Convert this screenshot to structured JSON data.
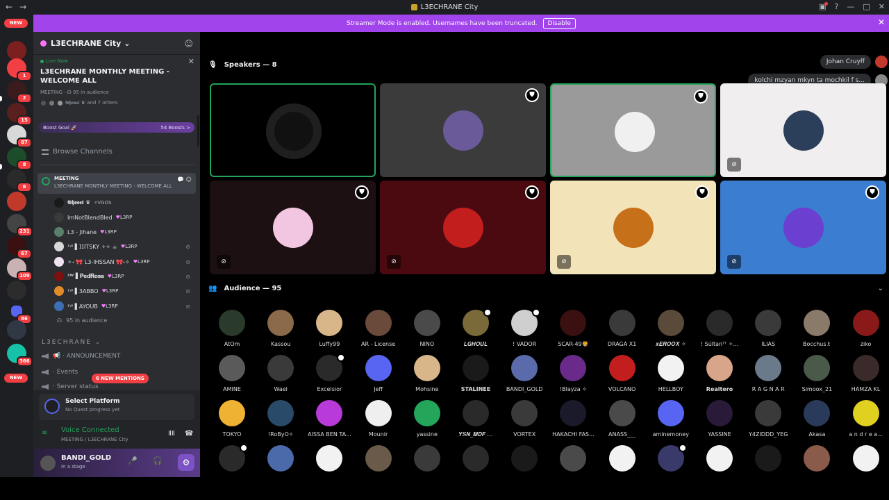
{
  "window": {
    "title": "L3ECHRANE City",
    "nav_back": "←",
    "nav_fwd": "→",
    "ctrl_inbox": "▣",
    "ctrl_help": "?",
    "ctrl_min": "—",
    "ctrl_max": "□",
    "ctrl_close": "✕"
  },
  "banner": {
    "text": "Streamer Mode is enabled. Usernames have been truncated.",
    "button": "Disable",
    "close": "✕"
  },
  "rail": {
    "new_top": "NEW",
    "new_bottom": "NEW",
    "badges": [
      "1",
      "2",
      "15",
      "87",
      "8",
      "6",
      "231",
      "67",
      "109",
      "86",
      "366"
    ],
    "colors": [
      "#7b1f1f",
      "#f23f43",
      "#3b1b1b",
      "#5a2020",
      "#d8d8d8",
      "#1b4d2b",
      "#2a2a2a",
      "#c0392b",
      "#444",
      "#3a1010",
      "#c9b2b2",
      "#2c2c2c",
      "#5865f2",
      "#303846",
      "#16c2a8"
    ]
  },
  "server": {
    "name": "L3ECHRANE City",
    "chevron": "⌄",
    "invite": "☺"
  },
  "live": {
    "label": "Live Now",
    "close": "✕",
    "title": "L3ECHRANE MONTHLY MEETING - WELCOME ALL",
    "meta": "MEETING · ☊ 95 in audience",
    "meta2": "𝕲𝖍𝖔𝖔𝖘𝖙 ♛ and 7 others"
  },
  "boost": {
    "label": "Boost Goal 🚀",
    "count": "54 Boosts >"
  },
  "browse": "Browse Channels",
  "stage": {
    "name": "MEETING",
    "topic": "L3ECHRANE MONTHLY MEETING - WELCOME ALL",
    "tools": "💬 ☺"
  },
  "members": [
    {
      "name": "𝕲𝖍𝖔𝖔𝖘𝖙 ♛",
      "role": "⚡VGOS",
      "color": "#1a1a1a",
      "bold": true,
      "mute": false,
      "plainrole": true
    },
    {
      "name": "ImNotBlendBled",
      "role": "L3RP",
      "color": "#3a3a3a",
      "bold": false,
      "mute": false
    },
    {
      "name": "L3 - Jihane",
      "role": "L3RP",
      "color": "#5a7f6a",
      "bold": false,
      "mute": false
    },
    {
      "name": "¹ᵂ ▌𝖨𝖨ITSKY ✧✧ ☕",
      "role": "L3RP",
      "color": "#d8d8d8",
      "bold": false,
      "mute": true
    },
    {
      "name": "✧˖ 🎀 L3-IHSSAN 🎀˖✧",
      "role": "L3RP",
      "color": "#efe3f0",
      "bold": false,
      "mute": true
    },
    {
      "name": "¹ᵂ ▌𝐏𝐞𝐝𝐑𝐨𝐬𝐚",
      "role": "L3RP",
      "color": "#7a1010",
      "bold": true,
      "mute": true
    },
    {
      "name": "¹ᵂ ▌3ABBO",
      "role": "L3RP",
      "color": "#e08a2a",
      "bold": false,
      "mute": true
    },
    {
      "name": "¹ᵂ ▌AYOUB",
      "role": "L3RP",
      "color": "#3d6fb5",
      "bold": false,
      "mute": true
    }
  ],
  "in_audience": "95 in audience",
  "category": "L3ECHRANE ⌄",
  "channels": [
    "📢 · ANNOUNCEMENT",
    "· Events",
    "· Server status"
  ],
  "mentions": "6 NEW MENTIONS",
  "quest": {
    "title": "Select Platform",
    "sub": "No Quest progress yet"
  },
  "voice": {
    "title": "Voice Connected",
    "sub": "MEETING / L3ECHRANE City",
    "wave": "ⅡⅡ",
    "phone": "☎"
  },
  "user": {
    "name": "BANDI_GOLD",
    "status": "In a stage",
    "mic": "🎤",
    "head": "🎧",
    "gear": "⚙"
  },
  "speakers": {
    "title": "Speakers — 8",
    "icon": "🎙"
  },
  "audience": {
    "title": "Audience — 95",
    "icon": "👥"
  },
  "bubbles": [
    "Johan Cruyff",
    "kolchi mzyan mkyn ta mochkil f s..."
  ],
  "tiles": [
    {
      "bg": "#000000",
      "av": "#111111",
      "speaking": true,
      "shield": false,
      "mute": false
    },
    {
      "bg": "#3b3b3b",
      "av": "#6b5a9a",
      "speaking": false,
      "shield": true,
      "mute": false
    },
    {
      "bg": "#9a9a9a",
      "av": "#f0f0f0",
      "speaking": true,
      "shield": true,
      "mute": false
    },
    {
      "bg": "#f0eeee",
      "av": "#2b3f5a",
      "speaking": false,
      "shield": false,
      "mute": true
    },
    {
      "bg": "#1c1013",
      "av": "#f2c6e0",
      "speaking": false,
      "shield": true,
      "mute": true
    },
    {
      "bg": "#4a0a10",
      "av": "#c21e1e",
      "speaking": false,
      "shield": true,
      "mute": true
    },
    {
      "bg": "#f3e3b8",
      "av": "#c7701a",
      "speaking": false,
      "shield": true,
      "mute": true
    },
    {
      "bg": "#3b7dd0",
      "av": "#6b3fd0",
      "speaking": false,
      "shield": true,
      "mute": true
    }
  ],
  "tile_icons": {
    "shield": "⛊",
    "mute": "⊘"
  },
  "audience_list": [
    {
      "n": "AtOm",
      "c": "#2b3b2b"
    },
    {
      "n": "Kassou",
      "c": "#8a6a4a"
    },
    {
      "n": "Luffy99",
      "c": "#d9b58a"
    },
    {
      "n": "AR - License",
      "c": "#6a4a3a"
    },
    {
      "n": "NINO",
      "c": "#4a4a4a"
    },
    {
      "n": "𝑳𝑮𝑯𝑶𝑼𝑳",
      "c": "#7a6a3a",
      "mod": true
    },
    {
      "n": "! VADOR",
      "c": "#cfcfcf",
      "mod": true
    },
    {
      "n": "SCAR-49🦁",
      "c": "#3a1010"
    },
    {
      "n": "DRAGA X1",
      "c": "#3a3a3a"
    },
    {
      "n": "𝒙𝑬𝑹𝑶𝑶𝑿 ✧",
      "c": "#5a4a3a"
    },
    {
      "n": "! Súltanᵀᵀ ✧...",
      "c": "#2a2a2a"
    },
    {
      "n": "ILIAS",
      "c": "#3a3a3a"
    },
    {
      "n": "Bocchus♗",
      "c": "#8a7a6a"
    },
    {
      "n": "ziko",
      "c": "#8a1a1a"
    },
    {
      "n": "AMINE",
      "c": "#5a5a5a"
    },
    {
      "n": "Wael",
      "c": "#3a3a3a"
    },
    {
      "n": "Excelsior",
      "c": "#2a2a2a",
      "mod": true
    },
    {
      "n": "Jeff",
      "c": "#5865f2"
    },
    {
      "n": "Mohsine",
      "c": "#d9b58a"
    },
    {
      "n": "STALINEE",
      "c": "#1a1a1a",
      "b": true
    },
    {
      "n": "BANDI_GOLD",
      "c": "#5a6aaa"
    },
    {
      "n": "!Blayza ✧",
      "c": "#6a2a8a"
    },
    {
      "n": "VOLCANO",
      "c": "#c21e1e"
    },
    {
      "n": "HELLBOY",
      "c": "#f2f2f2"
    },
    {
      "n": "Realtero",
      "c": "#d9a58a",
      "b": true
    },
    {
      "n": "R A G N A R",
      "c": "#6a7a8a"
    },
    {
      "n": "Simoox_21",
      "c": "#4a5a4a"
    },
    {
      "n": "HAMZA KL",
      "c": "#3a2a2a"
    },
    {
      "n": "TOKYO",
      "c": "#f0b232"
    },
    {
      "n": "!RoByO✧",
      "c": "#2a4a6a"
    },
    {
      "n": "AISSA BEN TA...",
      "c": "#b83ad8"
    },
    {
      "n": "Mounir",
      "c": "#efefef"
    },
    {
      "n": "yassine",
      "c": "#23a55a"
    },
    {
      "n": "𝒀𝑺𝑵_𝑴𝑫𝑭 ...",
      "c": "#2a2a2a"
    },
    {
      "n": "VORTEX",
      "c": "#3a3a3a"
    },
    {
      "n": "HAKACHI FAS...",
      "c": "#1a1a2a"
    },
    {
      "n": "ANASS___",
      "c": "#4a4a4a"
    },
    {
      "n": "aminemoney",
      "c": "#5865f2"
    },
    {
      "n": "YASSINE",
      "c": "#2a1a3a"
    },
    {
      "n": "Y4ZIDDD_YEG",
      "c": "#3a3a3a"
    },
    {
      "n": "Akasa",
      "c": "#2a3a5a"
    },
    {
      "n": "a n d r e a...",
      "c": "#e0d020"
    },
    {
      "n": "",
      "c": "#2a2a2a",
      "mod": true
    },
    {
      "n": "",
      "c": "#4a6aaa"
    },
    {
      "n": "",
      "c": "#f2f2f2"
    },
    {
      "n": "",
      "c": "#6a5a4a"
    },
    {
      "n": "",
      "c": "#3a3a3a"
    },
    {
      "n": "",
      "c": "#2a2a2a"
    },
    {
      "n": "",
      "c": "#1a1a1a"
    },
    {
      "n": "",
      "c": "#4a4a4a"
    },
    {
      "n": "",
      "c": "#f2f2f2"
    },
    {
      "n": "",
      "c": "#3a3a6a",
      "mod": true
    },
    {
      "n": "",
      "c": "#f2f2f2"
    },
    {
      "n": "",
      "c": "#1a1a1a"
    },
    {
      "n": "",
      "c": "#8a5a4a"
    },
    {
      "n": "",
      "c": "#f2f2f2"
    }
  ]
}
